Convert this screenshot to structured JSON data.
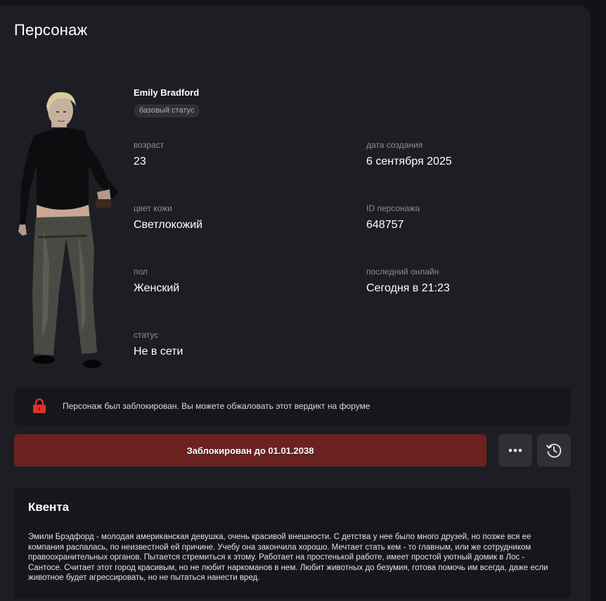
{
  "page": {
    "title": "Персонаж"
  },
  "character": {
    "name": "Emily Bradford",
    "badge": "базовый статус",
    "fields": {
      "age": {
        "label": "возраст",
        "value": "23"
      },
      "created": {
        "label": "дата создания",
        "value": "6 сентября 2025"
      },
      "skin": {
        "label": "цвет кожи",
        "value": "Светлокожий"
      },
      "char_id": {
        "label": "ID персонажа",
        "value": "648757"
      },
      "gender": {
        "label": "пол",
        "value": "Женский"
      },
      "last_online": {
        "label": "последний онлайн",
        "value": "Сегодня в 21:23"
      },
      "status": {
        "label": "статус",
        "value": "Не в сети"
      }
    }
  },
  "notice": {
    "icon": "lock-icon",
    "text": "Персонаж был заблокирован. Вы можете обжаловать этот вердикт на форуме"
  },
  "actions": {
    "ban_label": "Заблокирован до 01.01.2038",
    "more_icon": "more-dots-icon",
    "history_icon": "history-icon"
  },
  "story": {
    "title": "Квента",
    "text": "Эмили Брэдфорд - молодая американская девушка, очень красивой внешности. С детства у нее было много друзей, но позже вся ее компания распалась, по неизвестной ей причине. Учебу она закончила хорошо. Мечтает стать кем - то главным, или же сотрудником правоохранительных органов. Пытается стремиться к этому. Работает на простенькой работе, имеет простой уютный домик в Лос - Сантосе. Считает этот город красивым, но не любит наркоманов в нем. Любит животных до безумия, готова помочь им всегда, даже если животное будет агрессировать, но не пытаться нанести вред."
  },
  "colors": {
    "background": "#121318",
    "panel": "#1d1e24",
    "card": "#16171c",
    "ban_red": "#6b2320",
    "lock_red": "#e0302a",
    "icon_button": "#2e2f37"
  }
}
